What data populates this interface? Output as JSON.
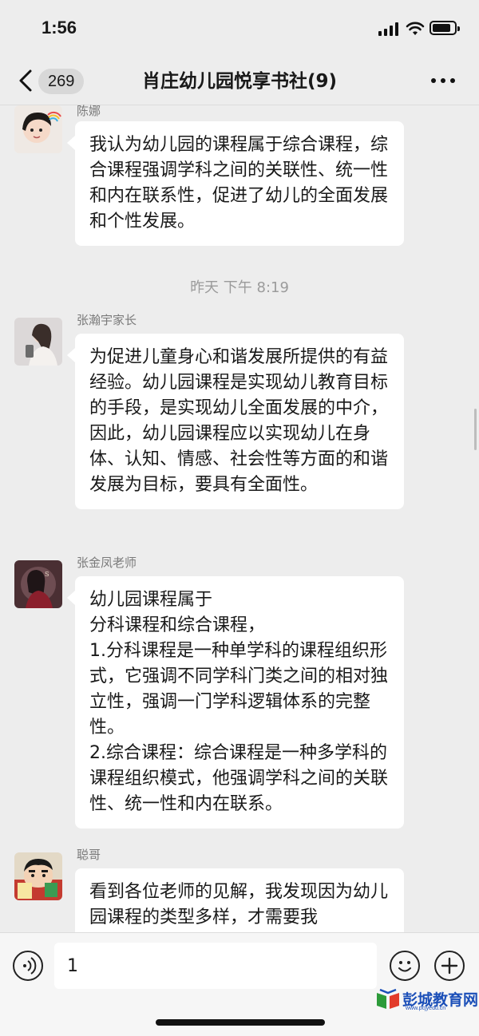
{
  "status_bar": {
    "time": "1:56"
  },
  "nav": {
    "unread_count": "269",
    "title": "肖庄幼儿园悦享书社(9)"
  },
  "messages": [
    {
      "sender": "陈娜",
      "text": "我认为幼儿园的课程属于综合课程，综合课程强调学科之间的关联性、统一性和内在联系性，促进了幼儿的全面发展和个性发展。"
    },
    {
      "sender": "张瀚宇家长",
      "text": "为促进儿童身心和谐发展所提供的有益经验。幼儿园课程是实现幼儿教育目标的手段，是实现幼儿全面发展的中介，因此，幼儿园课程应以实现幼儿在身体、认知、情感、社会性等方面的和谐发展为目标，要具有全面性。"
    },
    {
      "sender": "张金凤老师",
      "text": "幼儿园课程属于\n分科课程和综合课程，\n1.分科课程是一种单学科的课程组织形式，它强调不同学科门类之间的相对独立性，强调一门学科逻辑体系的完整性。\n2.综合课程：综合课程是一种多学科的课程组织模式，他强调学科之间的关联性、统一性和内在联系。"
    },
    {
      "sender": "聪哥",
      "text": "看到各位老师的见解，我发现因为幼儿园课程的类型多样，才需要我"
    }
  ],
  "time_separator": "昨天 下午 8:19",
  "input": {
    "value": "1"
  },
  "watermark": {
    "name": "彭城教育网",
    "url": "www.pcjyedu.cn"
  },
  "icons": {
    "back": "chevron-left-icon",
    "more": "more-dots-icon",
    "voice": "voice-icon",
    "emoji": "emoji-icon",
    "plus": "plus-icon"
  }
}
